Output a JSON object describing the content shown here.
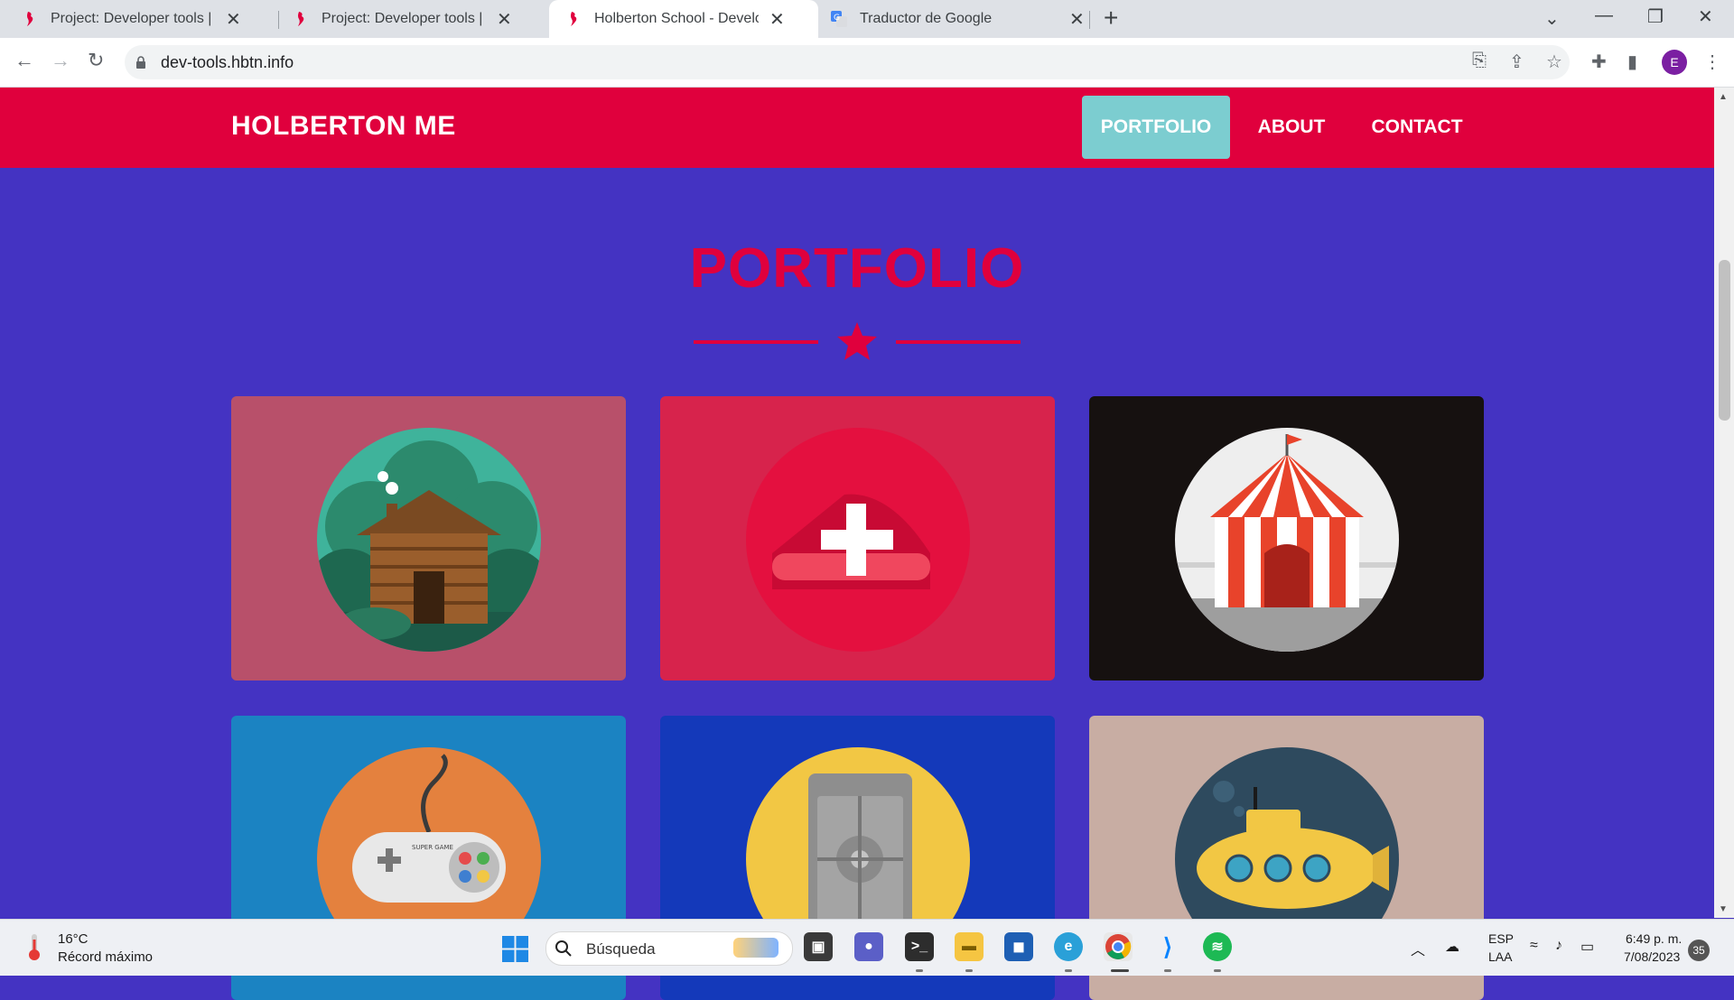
{
  "browser": {
    "tabs": [
      {
        "title": "Project: Developer tools | Holberton",
        "active": false
      },
      {
        "title": "Project: Developer tools | Holberton",
        "active": false
      },
      {
        "title": "Holberton School - Developer tools",
        "active": true
      },
      {
        "title": "Traductor de Google",
        "active": false
      }
    ],
    "new_tab": "+",
    "url": "dev-tools.hbtn.info",
    "profile_initial": "E"
  },
  "page": {
    "brand": "HOLBERTON ME",
    "nav": [
      "PORTFOLIO",
      "ABOUT",
      "CONTACT"
    ],
    "active_nav": "PORTFOLIO",
    "section_title": "PORTFOLIO",
    "colors": {
      "primary": "#e0003d",
      "background": "#4433c2",
      "nav_active": "#7ccdd0"
    },
    "portfolio_items": [
      {
        "icon": "cabin-icon",
        "bg": "#b8506a"
      },
      {
        "icon": "cake-icon",
        "bg": "#d7234c"
      },
      {
        "icon": "circus-tent-icon",
        "bg": "#161110"
      },
      {
        "icon": "game-controller-icon",
        "bg": "#1b83c2"
      },
      {
        "icon": "safe-icon",
        "bg": "#1439ba"
      },
      {
        "icon": "submarine-icon",
        "bg": "#c8ada3"
      }
    ],
    "controller_text": "SUPER GAME"
  },
  "taskbar": {
    "weather_temp": "16°C",
    "weather_desc": "Récord máximo",
    "search_placeholder": "Búsqueda",
    "lang_primary": "ESP",
    "lang_secondary": "LAA",
    "time": "6:49 p. m.",
    "date": "7/08/2023",
    "notification_count": "35"
  }
}
